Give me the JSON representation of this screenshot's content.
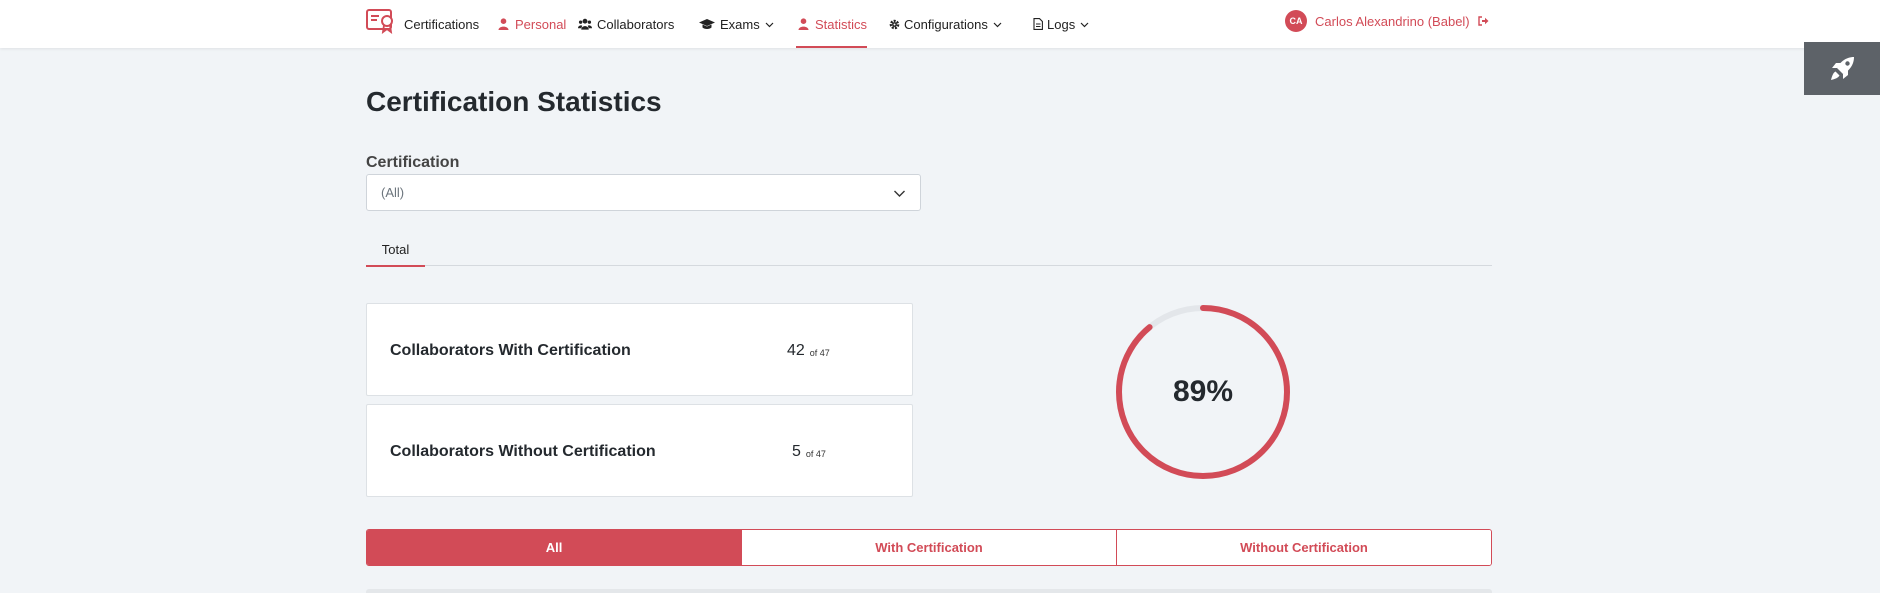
{
  "nav": {
    "items": [
      {
        "label": "Certifications"
      },
      {
        "label": "Personal"
      },
      {
        "label": "Collaborators"
      },
      {
        "label": "Exams"
      },
      {
        "label": "Statistics"
      },
      {
        "label": "Configurations"
      },
      {
        "label": "Logs"
      }
    ],
    "user": {
      "initials": "CA",
      "name": "Carlos Alexandrino (Babel)"
    }
  },
  "page": {
    "title": "Certification Statistics",
    "certification_label": "Certification",
    "certification_value": "(All)",
    "tabs": [
      {
        "label": "Total"
      }
    ]
  },
  "stats": {
    "with": {
      "label": "Collaborators With Certification",
      "value": "42",
      "of": "of 47"
    },
    "without": {
      "label": "Collaborators Without Certification",
      "value": "5",
      "of": "of 47"
    }
  },
  "gauge": {
    "percent_text": "89%",
    "fraction": 0.89
  },
  "filters": [
    {
      "label": "All"
    },
    {
      "label": "With Certification"
    },
    {
      "label": "Without Certification"
    }
  ],
  "colors": {
    "accent": "#d24b57",
    "track": "#e3e6ea"
  },
  "icons": [
    "certificate-logo-icon",
    "user-icon",
    "users-icon",
    "graduation-cap-icon",
    "gear-icon",
    "file-icon",
    "chevron-down-icon",
    "sign-out-icon",
    "rocket-icon"
  ]
}
